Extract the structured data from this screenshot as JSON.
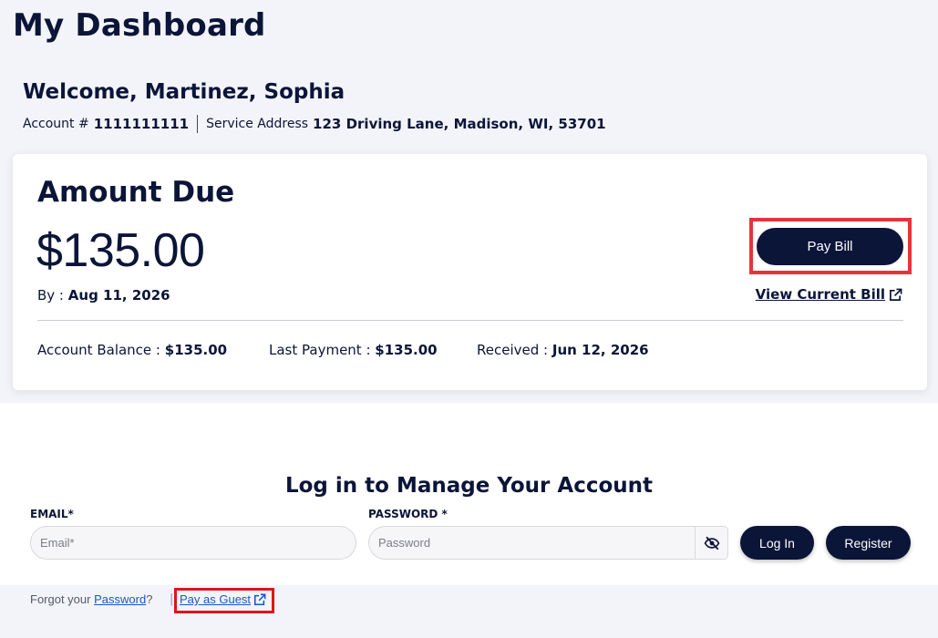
{
  "header": {
    "title": "My Dashboard"
  },
  "welcome": {
    "greeting": "Welcome, Martinez, Sophia",
    "account_label": "Account #",
    "account_number": "1111111111",
    "address_label": "Service Address",
    "address": "123 Driving Lane, Madison, WI, 53701"
  },
  "amount_card": {
    "title": "Amount Due",
    "amount": "$135.00",
    "due_label": "By :",
    "due_date": "Aug 11, 2026",
    "pay_button": "Pay Bill",
    "view_bill": "View Current Bill",
    "balance_label": "Account Balance :",
    "balance": "$135.00",
    "last_payment_label": "Last Payment :",
    "last_payment": "$135.00",
    "received_label": "Received :",
    "received": "Jun 12, 2026"
  },
  "login": {
    "title": "Log in to Manage Your Account",
    "email_label": "EMAIL*",
    "email_placeholder": "Email*",
    "password_label": "PASSWORD *",
    "password_placeholder": "Password",
    "login_button": "Log In",
    "register_button": "Register",
    "forgot_prefix": "Forgot your",
    "forgot_link": "Password",
    "forgot_suffix": "?",
    "separator": "|",
    "guest_link": "Pay as Guest"
  },
  "colors": {
    "primary": "#0b1538",
    "highlight": "#e5343b",
    "link": "#1a56c8",
    "background": "#f3f4f9"
  },
  "icons": {
    "external_link": "external-link-icon",
    "password_toggle": "eye-slash-icon"
  }
}
